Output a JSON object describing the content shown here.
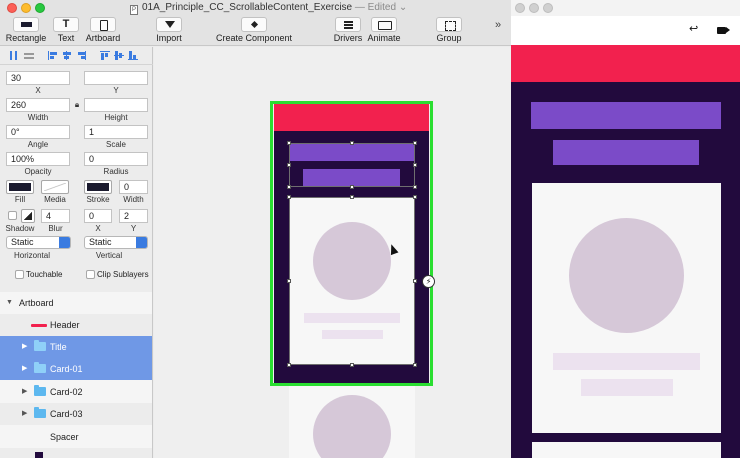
{
  "window": {
    "title": "01A_Principle_CC_ScrollableContent_Exercise",
    "edited": "— Edited",
    "doc_icon": "P"
  },
  "toolbar": {
    "items": [
      {
        "label": "Rectangle",
        "icon": "rectangle-icon"
      },
      {
        "label": "Text",
        "icon": "text-icon"
      },
      {
        "label": "Artboard",
        "icon": "artboard-icon"
      },
      {
        "label": "Import",
        "icon": "import-icon"
      },
      {
        "label": "Create Component",
        "icon": "component-icon"
      },
      {
        "label": "Drivers",
        "icon": "drivers-icon"
      },
      {
        "label": "Animate",
        "icon": "animate-icon"
      },
      {
        "label": "Group",
        "icon": "group-icon"
      }
    ],
    "more": "»"
  },
  "inspector": {
    "x": {
      "value": "30",
      "label": "X"
    },
    "y": {
      "value": "",
      "label": "Y"
    },
    "width": {
      "value": "260",
      "label": "Width"
    },
    "height": {
      "value": "",
      "label": "Height"
    },
    "angle": {
      "value": "0°",
      "label": "Angle"
    },
    "scale": {
      "value": "1",
      "label": "Scale"
    },
    "opacity": {
      "value": "100%",
      "label": "Opacity"
    },
    "radius": {
      "value": "0",
      "label": "Radius"
    },
    "fill_label": "Fill",
    "media_label": "Media",
    "stroke_label": "Stroke",
    "stroke_width": {
      "value": "0",
      "label": "Width"
    },
    "shadow_label": "Shadow",
    "blur": {
      "value": "4",
      "label": "Blur"
    },
    "shadow_x": {
      "value": "0",
      "label": "X"
    },
    "shadow_y": {
      "value": "2",
      "label": "Y"
    },
    "horizontal": {
      "value": "Static",
      "label": "Horizontal"
    },
    "vertical": {
      "value": "Static",
      "label": "Vertical"
    },
    "touchable": "Touchable",
    "clip_sublayers": "Clip Sublayers",
    "fill_color": "#1a1a2e",
    "stroke_color": "#1a1a2e"
  },
  "layers": [
    {
      "label": "Artboard",
      "indent": 0,
      "type": "artboard"
    },
    {
      "label": "Header",
      "indent": 1,
      "type": "line"
    },
    {
      "label": "Title",
      "indent": 1,
      "type": "folder",
      "selected": true
    },
    {
      "label": "Card-01",
      "indent": 1,
      "type": "folder",
      "selected": true
    },
    {
      "label": "Card-02",
      "indent": 1,
      "type": "folder"
    },
    {
      "label": "Card-03",
      "indent": 1,
      "type": "folder"
    },
    {
      "label": "Spacer",
      "indent": 1,
      "type": "none"
    }
  ],
  "colors": {
    "accent_red": "#f2214e",
    "accent_purple": "#7b4bc8",
    "dark_bg": "#220a3d",
    "selection_green": "#2ade31",
    "selected_row": "#6f98e6"
  },
  "preview": {
    "undo_icon": "undo-icon",
    "camera_icon": "camera-icon"
  }
}
